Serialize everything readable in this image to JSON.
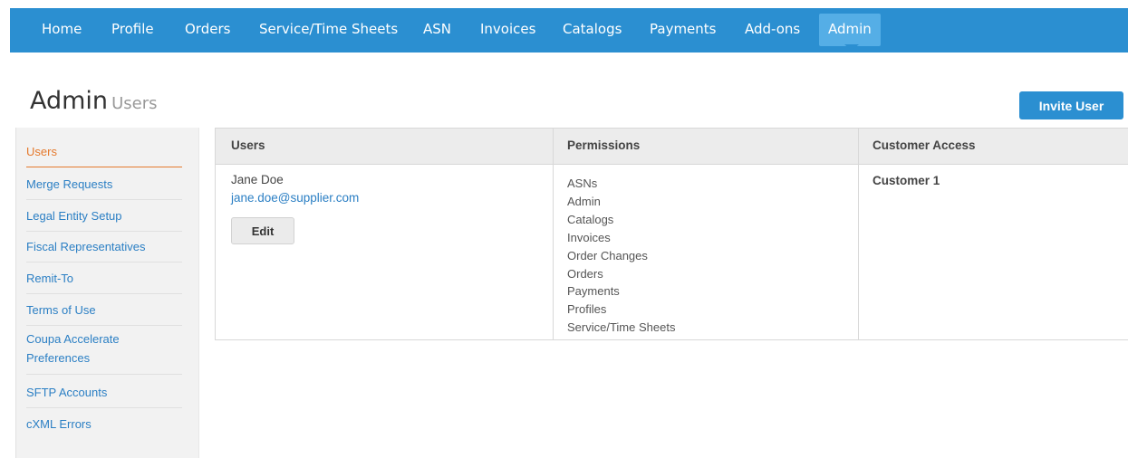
{
  "nav": {
    "items": [
      {
        "label": "Home"
      },
      {
        "label": "Profile"
      },
      {
        "label": "Orders"
      },
      {
        "label": "Service/Time Sheets"
      },
      {
        "label": "ASN"
      },
      {
        "label": "Invoices"
      },
      {
        "label": "Catalogs"
      },
      {
        "label": "Payments"
      },
      {
        "label": "Add-ons"
      },
      {
        "label": "Admin"
      }
    ],
    "active_index": 9,
    "color": "#2b8fd1",
    "active_color": "#55aee6"
  },
  "header": {
    "title": "Admin",
    "subtitle": "Users",
    "invite_button": "Invite User"
  },
  "sidebar": {
    "items": [
      {
        "label": "Users",
        "active": true
      },
      {
        "label": "Merge Requests"
      },
      {
        "label": "Legal Entity Setup"
      },
      {
        "label": "Fiscal Representatives"
      },
      {
        "label": "Remit-To"
      },
      {
        "label": "Terms of Use"
      },
      {
        "label": "Coupa Accelerate",
        "label2": "Preferences"
      },
      {
        "label": "SFTP Accounts"
      },
      {
        "label": "cXML Errors"
      }
    ],
    "active_color": "#e57a2e",
    "link_color": "#2b7fc4"
  },
  "table": {
    "columns": [
      "Users",
      "Permissions",
      "Customer Access"
    ],
    "rows": [
      {
        "user_name": "Jane Doe",
        "user_email": "jane.doe@supplier.com",
        "edit_label": "Edit",
        "permissions": [
          "ASNs",
          "Admin",
          "Catalogs",
          "Invoices",
          "Order Changes",
          "Orders",
          "Payments",
          "Profiles",
          "Service/Time Sheets"
        ],
        "customer_access": "Customer 1"
      }
    ]
  }
}
